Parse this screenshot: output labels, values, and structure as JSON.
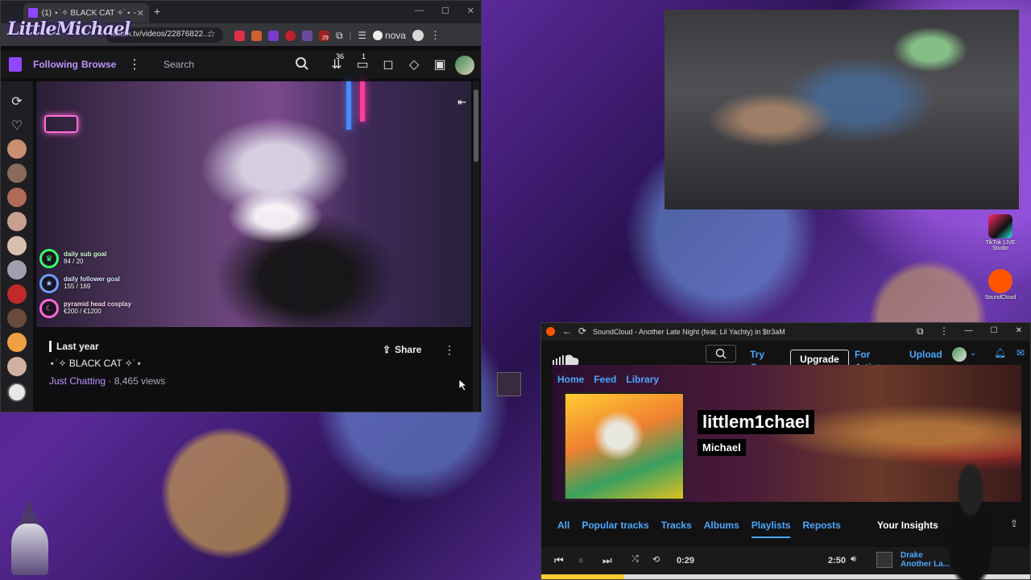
{
  "twitch": {
    "tab_title": "(1) ⋆˙✧ BLACK CAT ✧˙⋆ - Twitch",
    "url": "twitch.tv/videos/22876822...",
    "extension_label": "nova",
    "ext_badge": "29",
    "logo_text": "LittleMichael",
    "nav": {
      "following": "Following",
      "browse": "Browse",
      "search_placeholder": "Search",
      "badge_a": "36",
      "badge_b": "1"
    },
    "goals": [
      {
        "name": "daily sub goal",
        "value": "84 / 20"
      },
      {
        "name": "daily follower goal",
        "value": "155 / 169"
      },
      {
        "name": "pyramid head cosplay",
        "value": "€200 / €1200"
      }
    ],
    "info": {
      "date": "Last year",
      "title": "⋆˙✧ BLACK CAT ✧˙⋆",
      "category": "Just Chatting",
      "views": " · 8,465 views",
      "share": "Share"
    },
    "colors": {
      "accent": "#9146ff",
      "link": "#bf94ff"
    }
  },
  "desktop": {
    "shortcut_tiktok": "TikTok LIVE Studio",
    "shortcut_soundcloud": "SoundCloud"
  },
  "soundcloud": {
    "window_title": "SoundCloud - Another Late Night (feat. Lil Yachty) in $tr3aM",
    "header": {
      "try": "Try Go+",
      "upgrade": "Upgrade now",
      "for_artists": "For Artists",
      "upload": "Upload"
    },
    "banner_nav": [
      "Home",
      "Feed",
      "Library"
    ],
    "profile": {
      "username": "littlem1chael",
      "realname": "Michael"
    },
    "tabs": [
      "All",
      "Popular tracks",
      "Tracks",
      "Albums",
      "Playlists",
      "Reposts"
    ],
    "active_tab": "Playlists",
    "insights": "Your Insights",
    "player": {
      "elapsed": "0:29",
      "duration": "2:50",
      "progress": 0.17,
      "artist": "Drake",
      "track": "Another La..."
    },
    "colors": {
      "link": "#4aa8ff",
      "progress": "#ffcc33"
    }
  }
}
